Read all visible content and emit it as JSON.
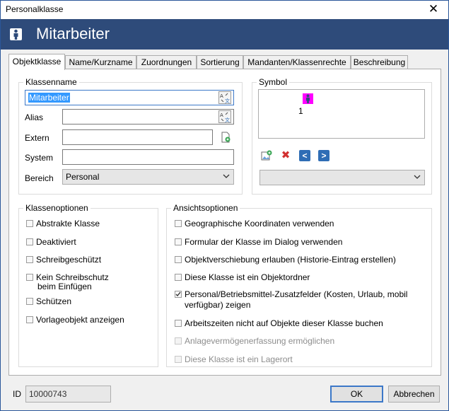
{
  "window": {
    "title": "Personalklasse",
    "close_label": "✕"
  },
  "banner": {
    "heading": "Mitarbeiter"
  },
  "tabs": [
    {
      "label": "Objektklasse",
      "active": true
    },
    {
      "label": "Name/Kurzname"
    },
    {
      "label": "Zuordnungen"
    },
    {
      "label": "Sortierung"
    },
    {
      "label": "Mandanten/Klassenrechte"
    },
    {
      "label": "Beschreibung"
    }
  ],
  "klassenname": {
    "legend": "Klassenname",
    "name_value": "Mitarbeiter",
    "alias_label": "Alias",
    "alias_value": "",
    "extern_label": "Extern",
    "extern_value": "",
    "system_label": "System",
    "system_value": "",
    "bereich_label": "Bereich",
    "bereich_value": "Personal"
  },
  "symbol": {
    "legend": "Symbol",
    "caption": "1",
    "dropdown_value": "",
    "prev_label": "<",
    "next_label": ">",
    "delete_label": "✖"
  },
  "klassenoptionen": {
    "legend": "Klassenoptionen",
    "items": [
      {
        "label": "Abstrakte Klasse",
        "checked": false
      },
      {
        "label": "Deaktiviert",
        "checked": false
      },
      {
        "label": "Schreibgeschützt",
        "checked": false
      },
      {
        "label": "Kein Schreibschutz",
        "label2": "beim Einfügen",
        "checked": false
      },
      {
        "label": "Schützen",
        "checked": false
      },
      {
        "label": "Vorlageobjekt anzeigen",
        "checked": false
      }
    ]
  },
  "ansichtsoptionen": {
    "legend": "Ansichtsoptionen",
    "items": [
      {
        "label": "Geographische Koordinaten verwenden",
        "checked": false
      },
      {
        "label": "Formular der Klasse im Dialog verwenden",
        "checked": false
      },
      {
        "label": "Objektverschiebung erlauben (Historie-Eintrag erstellen)",
        "checked": false
      },
      {
        "label": "Diese Klasse ist ein Objektordner",
        "checked": false
      },
      {
        "label": "Personal/Betriebsmittel-Zusatzfelder (Kosten, Urlaub, mobil",
        "label2": "verfügbar) zeigen",
        "checked": true
      },
      {
        "label": "Arbeitszeiten nicht auf Objekte dieser Klasse buchen",
        "checked": false
      },
      {
        "label": "Anlagevermögenerfassung ermöglichen",
        "checked": false,
        "disabled": true
      },
      {
        "label": "Diese Klasse ist ein Lagerort",
        "checked": false,
        "disabled": true
      }
    ]
  },
  "footer": {
    "id_label": "ID",
    "id_value": "10000743",
    "ok_label": "OK",
    "cancel_label": "Abbrechen"
  },
  "colors": {
    "banner": "#2e4b7a",
    "accent": "#2f6db5",
    "symbol_highlight": "#ff00ff"
  }
}
